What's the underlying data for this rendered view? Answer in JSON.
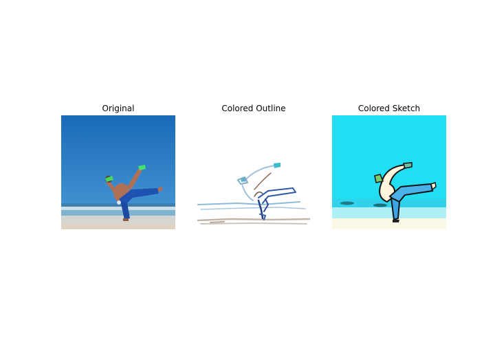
{
  "panels": [
    {
      "title": "Original"
    },
    {
      "title": "Colored Outline"
    },
    {
      "title": "Colored Sketch"
    }
  ],
  "colors": {
    "sky_original": "#1f74c0",
    "sea_original": "#4e9ccc",
    "sand_original": "#d9cfc2",
    "sky_sketch": "#22dff2",
    "sand_sketch": "#fbf9e8",
    "pants_blue": "#1e4fa8",
    "glove_green": "#3ad36a"
  }
}
